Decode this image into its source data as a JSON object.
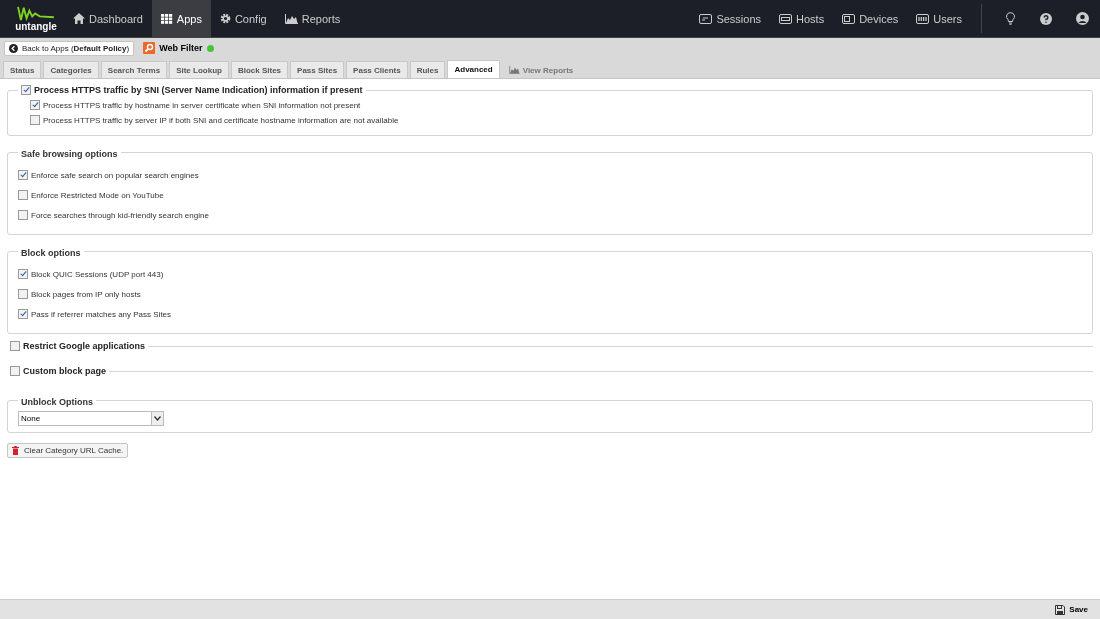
{
  "nav": {
    "logo": "untangle",
    "left": [
      {
        "label": "Dashboard",
        "kind": "home",
        "selected": false
      },
      {
        "label": "Apps",
        "kind": "grid",
        "selected": true
      },
      {
        "label": "Config",
        "kind": "gear",
        "selected": false
      },
      {
        "label": "Reports",
        "kind": "chart",
        "selected": false
      }
    ],
    "right": [
      {
        "label": "Sessions",
        "kind": "monitor"
      },
      {
        "label": "Hosts",
        "kind": "host"
      },
      {
        "label": "Devices",
        "kind": "device"
      },
      {
        "label": "Users",
        "kind": "users"
      }
    ]
  },
  "toolbar": {
    "back": "Back to Apps (**Default Policy**)",
    "app": "Web Filter",
    "running": true
  },
  "tabs": [
    {
      "label": "Status",
      "selected": false,
      "kind": "tab"
    },
    {
      "label": "Categories",
      "selected": false,
      "kind": "tab"
    },
    {
      "label": "Search Terms",
      "selected": false,
      "kind": "tab"
    },
    {
      "label": "Site Lookup",
      "selected": false,
      "kind": "tab"
    },
    {
      "label": "Block Sites",
      "selected": false,
      "kind": "tab"
    },
    {
      "label": "Pass Sites",
      "selected": false,
      "kind": "tab"
    },
    {
      "label": "Pass Clients",
      "selected": false,
      "kind": "tab"
    },
    {
      "label": "Rules",
      "selected": false,
      "kind": "tab"
    },
    {
      "label": "Advanced",
      "selected": true,
      "kind": "tab"
    },
    {
      "label": "View Reports",
      "selected": false,
      "kind": "report"
    }
  ],
  "sections": [
    {
      "kind": "check_legend",
      "label": "Process HTTPS traffic by SNI (Server Name Indication) information if present",
      "checked": true,
      "expanded": true,
      "items": [
        {
          "label": "Process HTTPS traffic by hostname in server certificate when SNI information not present",
          "checked": true
        },
        {
          "label": "Process HTTPS traffic by server IP if both SNI and certificate hostname information are not available",
          "checked": false
        }
      ]
    },
    {
      "kind": "group",
      "title": "Safe browsing options",
      "items": [
        {
          "label": "Enforce safe search on popular search engines",
          "checked": true
        },
        {
          "label": "Enforce Restricted Mode on YouTube",
          "checked": false
        },
        {
          "label": "Force searches through kid-friendly search engine",
          "checked": false
        }
      ]
    },
    {
      "kind": "group",
      "title": "Block options",
      "items": [
        {
          "label": "Block QUIC Sessions (UDP port 443)",
          "checked": true
        },
        {
          "label": "Block pages from IP only hosts",
          "checked": false
        },
        {
          "label": "Pass if referrer matches any Pass Sites",
          "checked": true
        }
      ]
    },
    {
      "kind": "check_legend",
      "label": "Restrict Google applications",
      "checked": false,
      "expanded": false
    },
    {
      "kind": "check_legend",
      "label": "Custom block page",
      "checked": false,
      "expanded": false
    },
    {
      "kind": "select",
      "title": "Unblock Options",
      "value": "None"
    }
  ],
  "clear_button": "Clear Category URL Cache.",
  "save_button": "Save"
}
